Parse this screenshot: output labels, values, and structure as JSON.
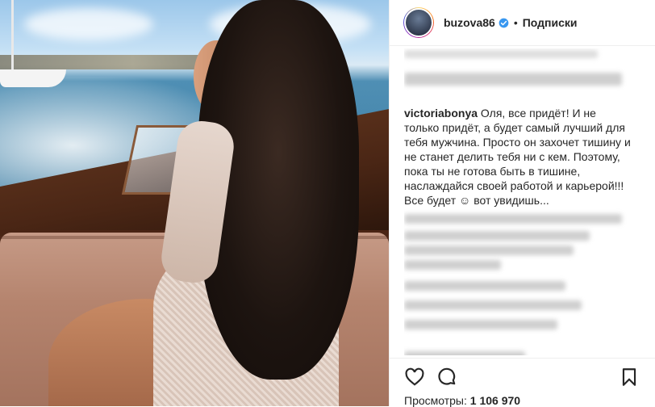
{
  "post": {
    "username": "buzova86",
    "follow_label": "Подписки",
    "separator": "•"
  },
  "comment": {
    "author": "victoriabonya",
    "text": "Оля, все придёт! И не только придёт, а будет самый лучший для тебя мужчина. Просто он захочет тишину и не станет делить тебя ни с кем. Поэтому, пока ты не готова быть в тишине, наслаждайся своей работой и карьерой!!! Все будет ☺ вот увидишь..."
  },
  "stats": {
    "views_label": "Просмотры:",
    "views_value": "1 106 970"
  },
  "icons": {
    "like": "heart-icon",
    "comment": "comment-icon",
    "save": "bookmark-icon",
    "verified": "verified-badge-icon"
  },
  "colors": {
    "text": "#262626",
    "verified": "#3897f0",
    "border": "#efefef"
  }
}
